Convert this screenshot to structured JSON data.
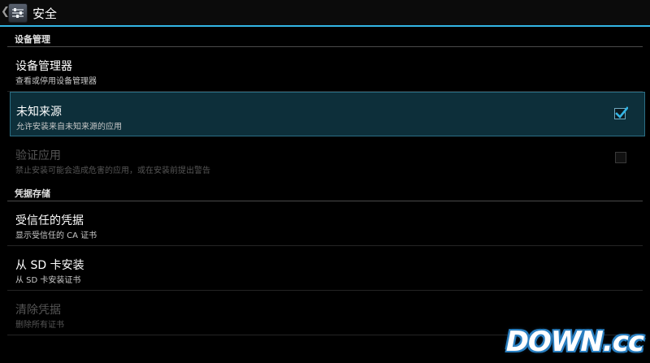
{
  "actionbar": {
    "title": "安全",
    "up_icon": "chevron-left-icon",
    "app_icon": "security-settings-icon"
  },
  "sections": [
    {
      "header": "设备管理",
      "items": [
        {
          "title": "设备管理器",
          "summary": "查看或停用设备管理器"
        },
        {
          "title": "未知来源",
          "summary": "允许安装来自未知来源的应用",
          "checked": true,
          "selected": true
        },
        {
          "title": "验证应用",
          "summary": "禁止安装可能会造成危害的应用，或在安装前提出警告",
          "checked": false,
          "disabled": true
        }
      ]
    },
    {
      "header": "凭据存储",
      "items": [
        {
          "title": "受信任的凭据",
          "summary": "显示受信任的 CA 证书"
        },
        {
          "title": "从 SD 卡安装",
          "summary": "从 SD 卡安装证书"
        },
        {
          "title": "清除凭据",
          "summary": "删除所有证书",
          "disabled": true
        }
      ]
    }
  ],
  "watermark": "DOWN.cc",
  "colors": {
    "accent": "#33b5e5",
    "selected_bg": "#0d2f3a",
    "selected_border": "#2b6f85",
    "background": "#000000"
  }
}
